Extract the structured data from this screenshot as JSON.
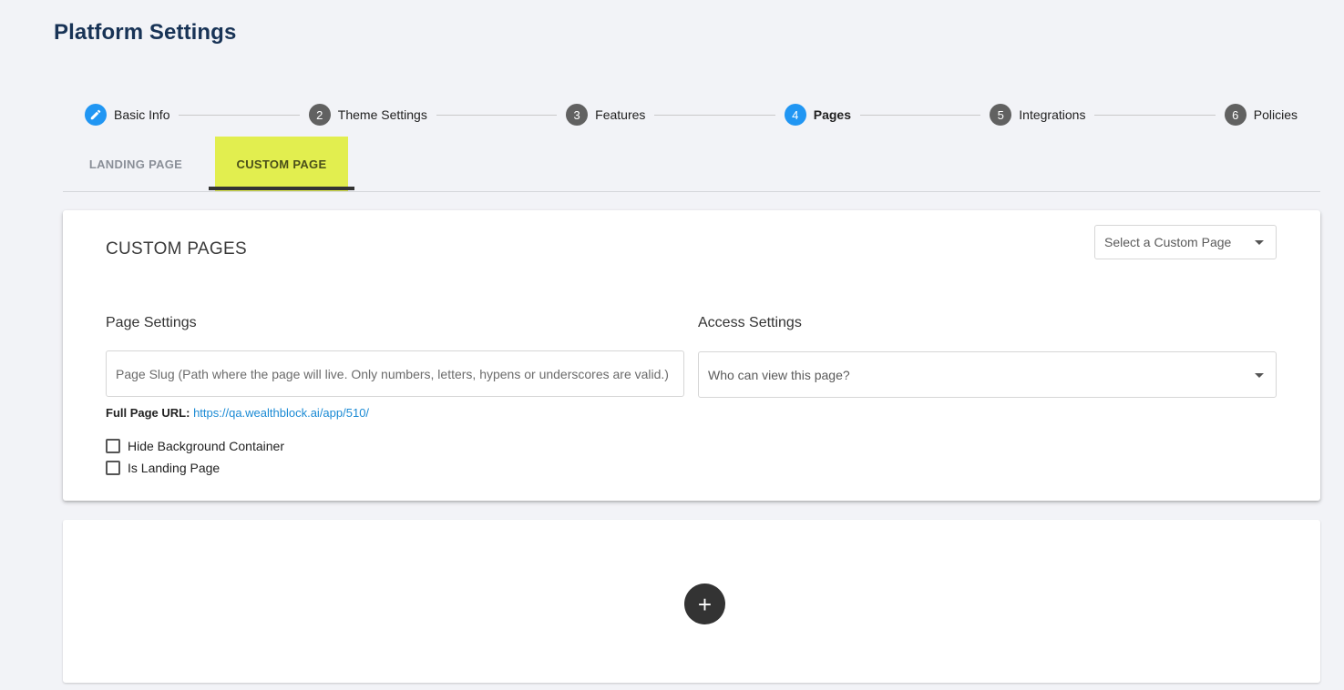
{
  "page": {
    "title": "Platform Settings"
  },
  "stepper": {
    "steps": [
      {
        "number": "",
        "label": "Basic Info",
        "icon": "pencil-icon"
      },
      {
        "number": "2",
        "label": "Theme Settings"
      },
      {
        "number": "3",
        "label": "Features"
      },
      {
        "number": "4",
        "label": "Pages"
      },
      {
        "number": "5",
        "label": "Integrations"
      },
      {
        "number": "6",
        "label": "Policies"
      }
    ],
    "active_color": "#2196f3",
    "inactive_color": "#616161"
  },
  "tabs": {
    "landing": "LANDING PAGE",
    "custom": "CUSTOM PAGE",
    "highlight_color": "#e2ee4f"
  },
  "custom_pages": {
    "title": "CUSTOM PAGES",
    "select_placeholder": "Select a Custom Page",
    "page_settings_title": "Page Settings",
    "access_settings_title": "Access Settings",
    "slug_placeholder": "Page Slug (Path where the page will live. Only numbers, letters, hypens or underscores are valid.)",
    "access_placeholder": "Who can view this page?",
    "full_url_label": "Full Page URL:",
    "full_url_value": "https://qa.wealthblock.ai/app/510/",
    "hide_bg_label": "Hide Background Container",
    "is_landing_label": "Is Landing Page"
  },
  "add_button": {
    "label": "+"
  }
}
